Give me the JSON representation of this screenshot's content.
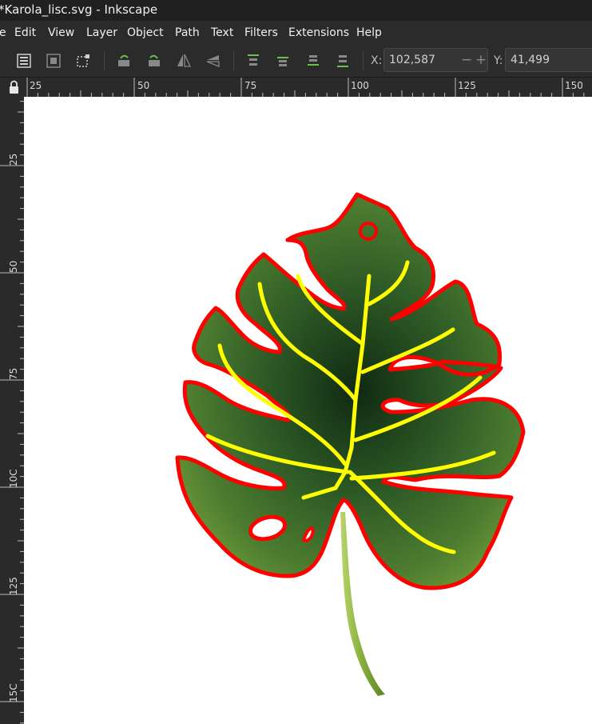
{
  "window": {
    "title": "*Karola_lisc.svg - Inkscape"
  },
  "menu": {
    "items": [
      {
        "id": "file",
        "label": "e"
      },
      {
        "id": "edit",
        "label": "Edit"
      },
      {
        "id": "view",
        "label": "View"
      },
      {
        "id": "layer",
        "label": "Layer"
      },
      {
        "id": "object",
        "label": "Object"
      },
      {
        "id": "path",
        "label": "Path"
      },
      {
        "id": "text",
        "label": "Text"
      },
      {
        "id": "filters",
        "label": "Filters"
      },
      {
        "id": "extensions",
        "label": "Extensions"
      },
      {
        "id": "help",
        "label": "Help"
      }
    ]
  },
  "toolbar": {
    "x_label": "X:",
    "x_value": "102,587",
    "y_label": "Y:",
    "y_value": "41,499",
    "minus_glyph": "−",
    "plus_glyph": "+",
    "icons": [
      "select-all-icon",
      "select-all-layers-icon",
      "deselect-icon",
      "rotate-ccw-icon",
      "rotate-cw-icon",
      "flip-horizontal-icon",
      "flip-vertical-icon",
      "raise-to-top-icon",
      "raise-icon",
      "lower-icon",
      "lower-to-bottom-icon"
    ]
  },
  "rulers": {
    "horizontal_labels": [
      "25",
      "50",
      "75",
      "100",
      "125",
      "150"
    ],
    "vertical_labels": [
      "25",
      "50",
      "75",
      "10C",
      "125",
      "15C"
    ],
    "lock_icon": "lock-icon"
  },
  "canvas": {
    "background": "#ffffff",
    "outline_color": "#ff0000",
    "vein_color": "#ffff00",
    "leaf_dark": "#1e3f1c",
    "leaf_light": "#6e9a38",
    "stem_color": "#8fb84a"
  }
}
